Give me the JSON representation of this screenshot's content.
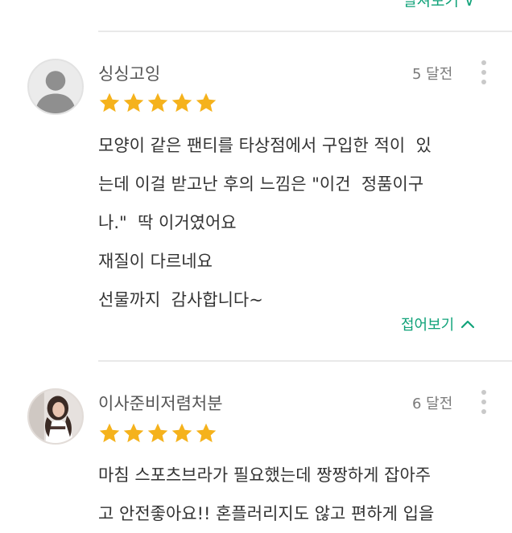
{
  "top": {
    "expand_label": "펼쳐보기 ∨"
  },
  "reviews": [
    {
      "author": "싱싱고잉",
      "date": "5 달전",
      "rating": 5,
      "avatar": "default-person-icon",
      "lines": [
        "모양이 같은 팬티를 타상점에서 구입한 적이  있",
        "는데 이걸 받고난 후의 느낌은 \"이건  정품이구",
        "나.\"  딱 이거였어요",
        "재질이 다르네요",
        "선물까지  감사합니다~"
      ],
      "collapse_label": "접어보기"
    },
    {
      "author": "이사준비저렴처분",
      "date": "6 달전",
      "rating": 5,
      "avatar": "profile-photo",
      "lines": [
        "마침 스포츠브라가 필요했는데 짱짱하게 잡아주",
        "고 안전좋아요!! 혼플러리지도 않고 편하게 입을"
      ]
    }
  ],
  "colors": {
    "accent": "#12a37a",
    "star": "#f5b21c",
    "text": "#333333",
    "muted": "#7a7a7a",
    "divider": "#e9e9e9"
  }
}
